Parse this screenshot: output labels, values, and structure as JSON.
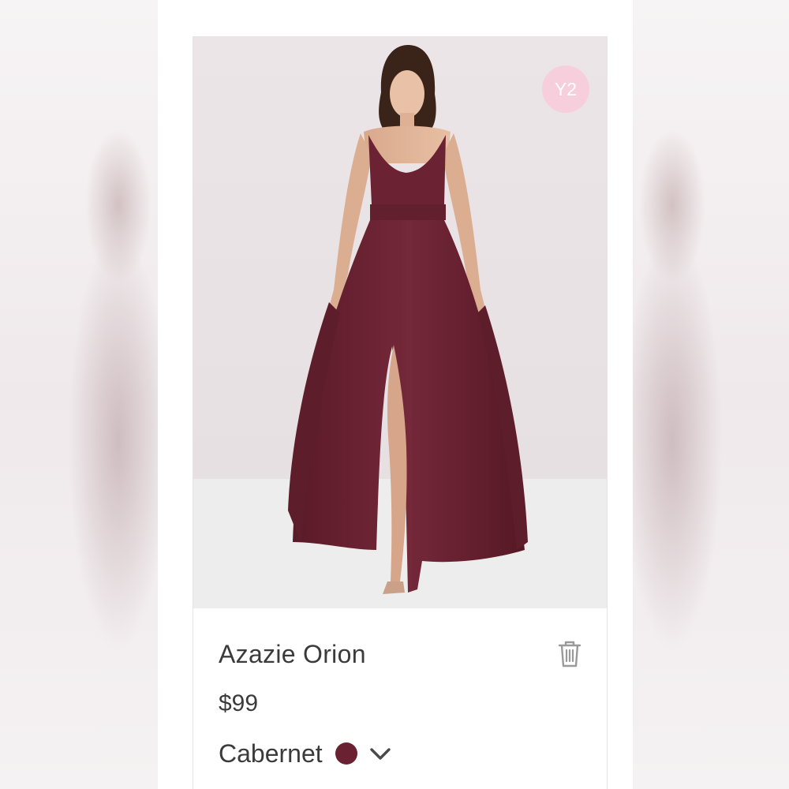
{
  "product": {
    "badge": "Y2",
    "name": "Azazie Orion",
    "price": "$99",
    "color_name": "Cabernet",
    "swatch_color": "#6a2232",
    "image": "dress-model-photo"
  },
  "icons": {
    "delete": "trash-icon",
    "expand": "chevron-down-icon"
  }
}
